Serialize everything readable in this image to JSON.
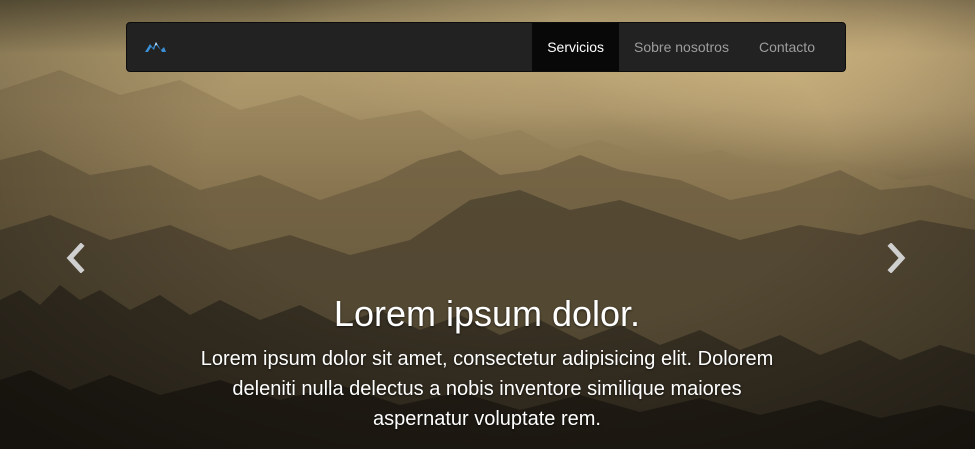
{
  "navbar": {
    "brand_icon": "mountain-logo-icon",
    "items": [
      {
        "label": "Servicios",
        "active": true
      },
      {
        "label": "Sobre nosotros",
        "active": false
      },
      {
        "label": "Contacto",
        "active": false
      }
    ]
  },
  "carousel": {
    "prev_icon": "chevron-left-icon",
    "next_icon": "chevron-right-icon",
    "caption": {
      "title": "Lorem ipsum dolor.",
      "text": "Lorem ipsum dolor sit amet, consectetur adipisicing elit. Dolorem deleniti nulla delectus a nobis inventore similique maiores aspernatur voluptate rem."
    }
  },
  "colors": {
    "navbar_bg": "#222222",
    "navbar_active_bg": "#080808",
    "nav_text": "#9d9d9d",
    "brand_blue": "#3a8fd6"
  }
}
